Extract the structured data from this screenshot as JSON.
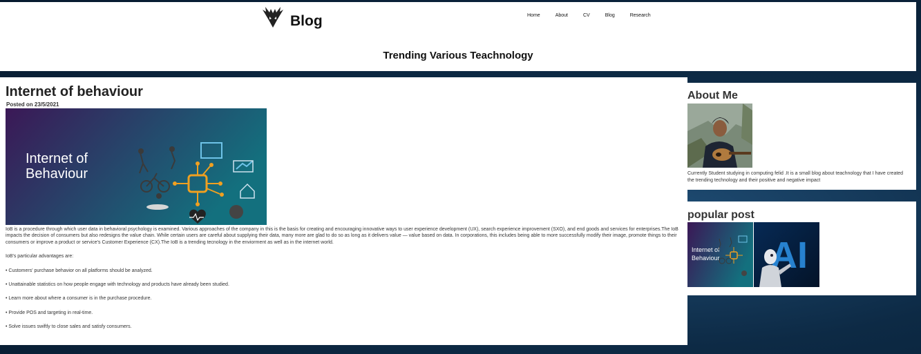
{
  "header": {
    "site_title": "Blog",
    "tagline": "Trending Various Teachnology",
    "nav": [
      "Home",
      "About",
      "CV",
      "Blog",
      "Research"
    ]
  },
  "post": {
    "title": "Internet of behaviour",
    "date": "Posted on 23/5/2021",
    "image_text": [
      "Internet of",
      "Behaviour"
    ],
    "intro": "IoB is a procedure through which user data in behavioral psychology is examined. Various approaches of the company in this is the basis for creating and encouraging innovative ways to user experience development (UX), search experience improvement (SXO), and end goods and services for enterprises.The IoB impacts the decision of consumers but also redesigns the value chain. While certain users are careful about supplying their data, many more are glad to do so as long as it delivers value — value based on data. In corporations, this includes being able to more successfully modify their image, promote things to their consumers or improve a product or service's Customer Experience (CX).The IoB is a trending tecnology in the enviorment as well as in the internet world.",
    "advantages_heading": "IoB's particular advantages are:",
    "advantages": [
      "• Customers' purchase behavior on all platforms should be analyzed.",
      "• Unattainable statistics on how people engage with technology and products have already been studied.",
      "• Learn more about where a consumer is in the purchase procedure.",
      "• Provide POS and targeting in real-time.",
      "• Solve issues swiftly to close sales and satisfy consumers."
    ]
  },
  "sidebar": {
    "about_title": "About Me",
    "about_text": "Currently Student studying in computing felid .It is a small blog about teachnology that I have created the trending technology and their positive and negative impact",
    "popular_title": "popular post",
    "popular_thumbs": [
      {
        "lines": [
          "Internet of",
          "Behaviour"
        ]
      },
      {
        "text": "AI"
      }
    ]
  },
  "colors": {
    "background": "#0d2a45",
    "gradient_start": "#3b1856",
    "gradient_end": "#13707e",
    "accent_orange": "#f0a020",
    "ai_blue": "#2b8de0"
  },
  "icons": [
    "logo-icon"
  ]
}
